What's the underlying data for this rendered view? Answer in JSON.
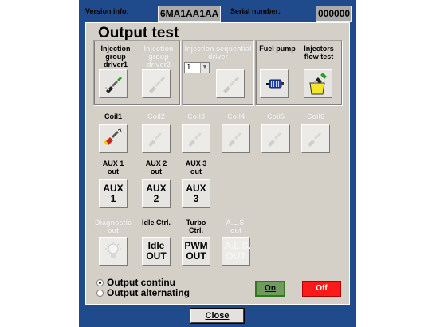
{
  "header": {
    "version_label": "Version info:",
    "version_value": "6MA1AA1AA",
    "serial_label": "Serial number:",
    "serial_value": "000000"
  },
  "panel": {
    "title": "Output test"
  },
  "row1": {
    "injection_group_driver1": "Injection group driver1",
    "injection_group_driver2": "Injection group driver2",
    "injection_sequential_driver": "Injection sequential driver",
    "sequential_select_value": "1",
    "fuel_pump": "Fuel pump",
    "injectors_flow_test": "Injectors flow test"
  },
  "coils": [
    "Coil1",
    "Coil2",
    "Coil3",
    "Coil4",
    "Coil5",
    "Coil6"
  ],
  "aux": {
    "labels": [
      "AUX 1 out",
      "AUX 2 out",
      "AUX 3 out"
    ],
    "buttons": [
      "AUX 1",
      "AUX 2",
      "AUX 3"
    ]
  },
  "row4": {
    "diagnostic_out": "Diagnostic out",
    "idle_ctrl": "Idle Ctrl.",
    "idle_button": "Idle OUT",
    "turbo_ctrl": "Turbo Ctrl.",
    "turbo_button": "PWM OUT",
    "als_out": "A.L.S. out",
    "als_button": "A.L.S. OUT"
  },
  "mode": {
    "option1": "Output continu",
    "option2": "Output alternating",
    "selected": "Output continu"
  },
  "controls": {
    "on_label": "On",
    "off_label": "Off",
    "close_label": "Close"
  },
  "colors": {
    "frame_blue": "#1f4a8c",
    "panel_gray": "#d4d0c8",
    "on_green": "#6f9b5f",
    "off_red": "#ff1919"
  }
}
